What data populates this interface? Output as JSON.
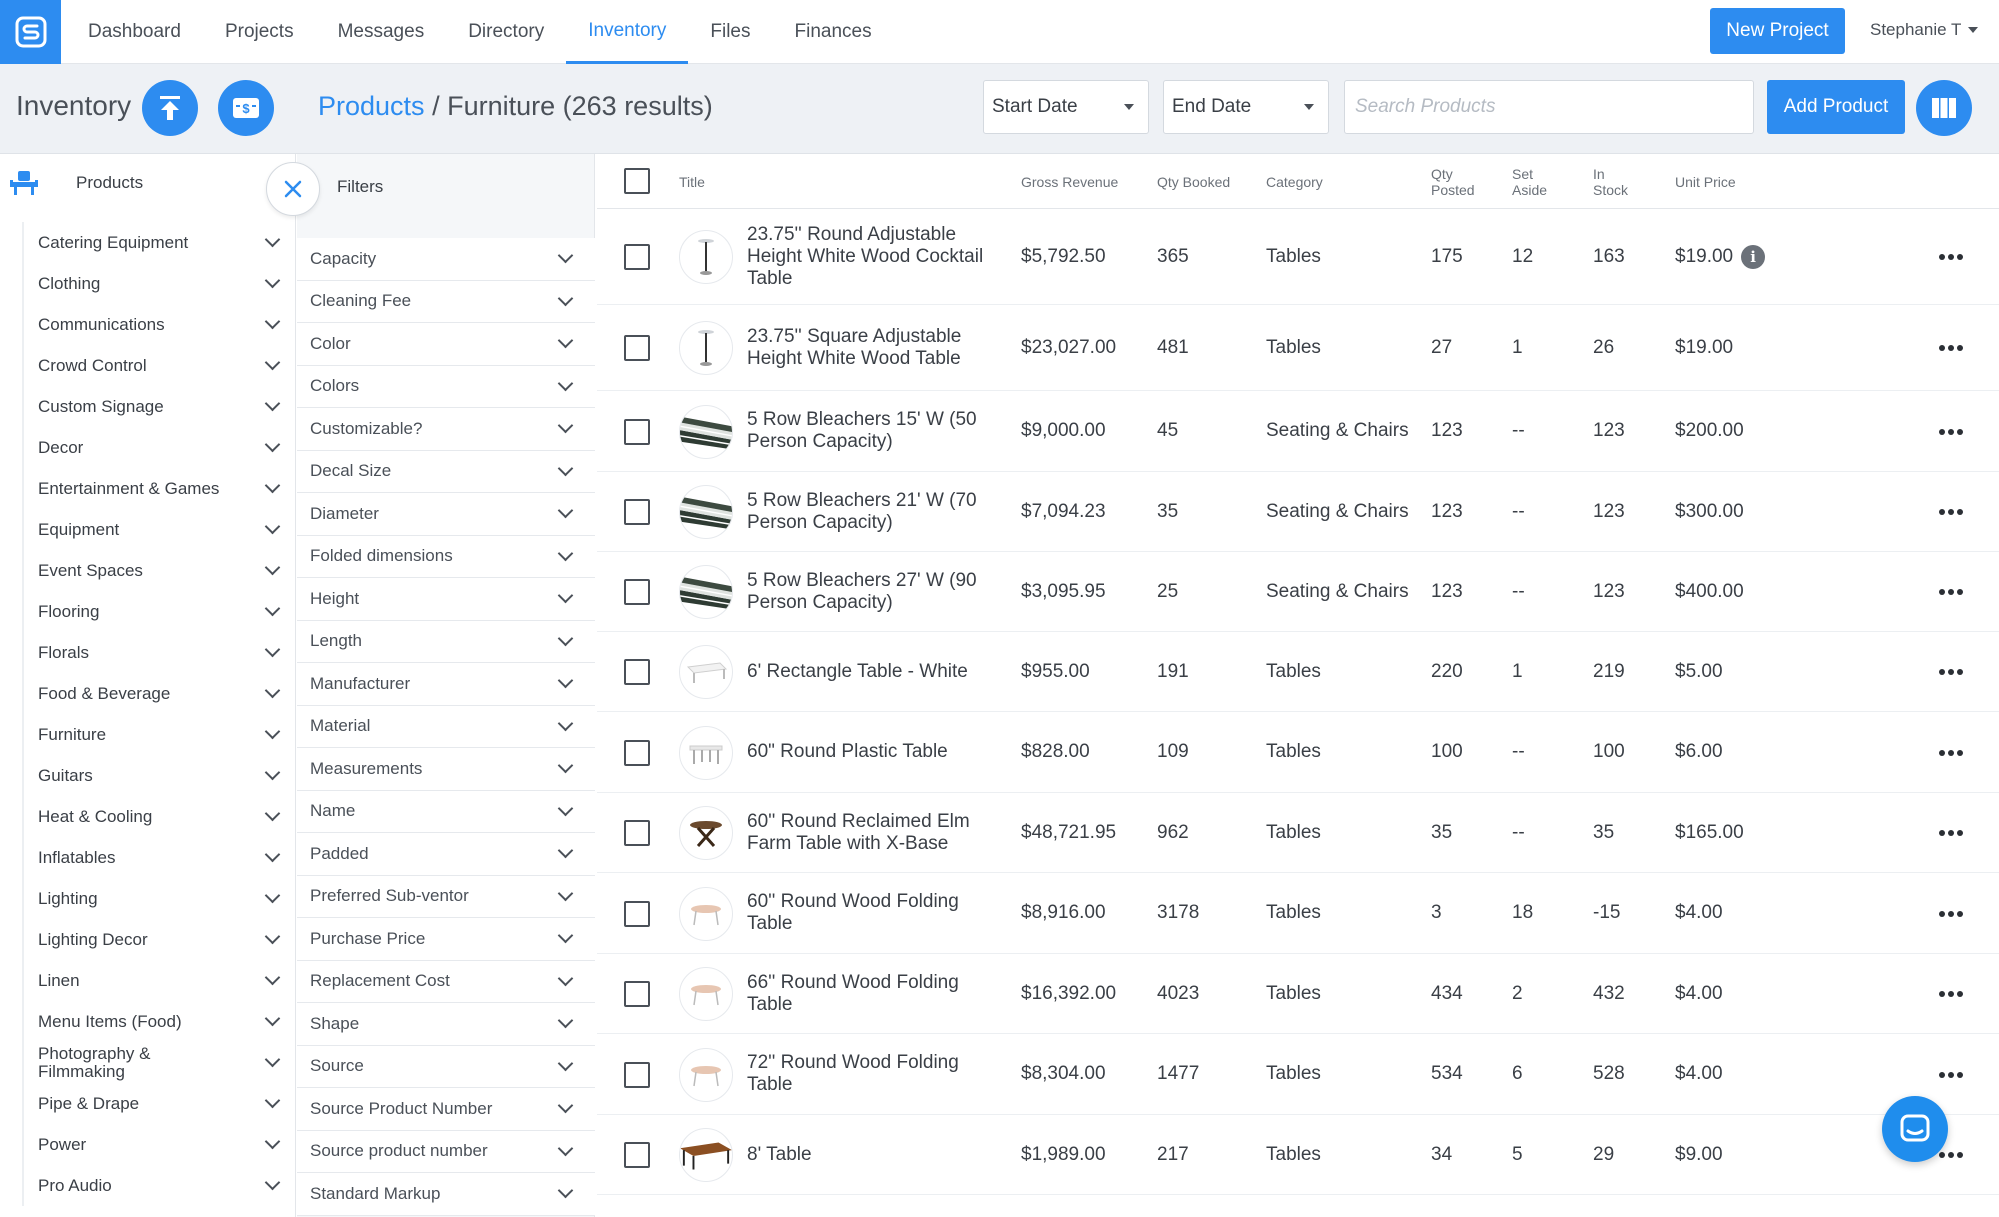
{
  "colors": {
    "accent": "#2d8cf0"
  },
  "nav": {
    "tabs": [
      {
        "label": "Dashboard"
      },
      {
        "label": "Projects"
      },
      {
        "label": "Messages"
      },
      {
        "label": "Directory"
      },
      {
        "label": "Inventory"
      },
      {
        "label": "Files"
      },
      {
        "label": "Finances"
      }
    ],
    "active_tab": "Inventory",
    "new_project_label": "New Project",
    "user_name": "Stephanie T"
  },
  "subheader": {
    "title": "Inventory",
    "breadcrumb_link": "Products",
    "breadcrumb_sep": "/",
    "breadcrumb_current": "Furniture (263 results)",
    "start_date_label": "Start Date",
    "end_date_label": "End Date",
    "search_placeholder": "Search Products",
    "add_product_label": "Add Product"
  },
  "categories": {
    "header": "Products",
    "items": [
      {
        "label": "Catering Equipment"
      },
      {
        "label": "Clothing"
      },
      {
        "label": "Communications"
      },
      {
        "label": "Crowd Control"
      },
      {
        "label": "Custom Signage"
      },
      {
        "label": "Decor"
      },
      {
        "label": "Entertainment & Games"
      },
      {
        "label": "Equipment"
      },
      {
        "label": "Event Spaces"
      },
      {
        "label": "Flooring"
      },
      {
        "label": "Florals"
      },
      {
        "label": "Food & Beverage"
      },
      {
        "label": "Furniture"
      },
      {
        "label": "Guitars"
      },
      {
        "label": "Heat & Cooling"
      },
      {
        "label": "Inflatables"
      },
      {
        "label": "Lighting"
      },
      {
        "label": "Lighting Decor"
      },
      {
        "label": "Linen"
      },
      {
        "label": "Menu Items (Food)"
      },
      {
        "label": "Photography & Filmmaking"
      },
      {
        "label": "Pipe & Drape"
      },
      {
        "label": "Power"
      },
      {
        "label": "Pro Audio"
      }
    ]
  },
  "filters": {
    "title": "Filters",
    "items": [
      {
        "label": "Capacity"
      },
      {
        "label": "Cleaning Fee"
      },
      {
        "label": "Color"
      },
      {
        "label": "Colors"
      },
      {
        "label": "Customizable?"
      },
      {
        "label": "Decal Size"
      },
      {
        "label": "Diameter"
      },
      {
        "label": "Folded dimensions"
      },
      {
        "label": "Height"
      },
      {
        "label": "Length"
      },
      {
        "label": "Manufacturer"
      },
      {
        "label": "Material"
      },
      {
        "label": "Measurements"
      },
      {
        "label": "Name"
      },
      {
        "label": "Padded"
      },
      {
        "label": "Preferred Sub-ventor"
      },
      {
        "label": "Purchase Price"
      },
      {
        "label": "Replacement Cost"
      },
      {
        "label": "Shape"
      },
      {
        "label": "Source"
      },
      {
        "label": "Source Product Number"
      },
      {
        "label": "Source product number"
      },
      {
        "label": "Standard Markup"
      }
    ]
  },
  "table": {
    "headers": {
      "title": "Title",
      "gross_revenue": "Gross Revenue",
      "qty_booked": "Qty Booked",
      "category": "Category",
      "qty_posted": "Qty Posted",
      "set_aside": "Set Aside",
      "in_stock": "In Stock",
      "unit_price": "Unit Price"
    },
    "rows": [
      {
        "title": "23.75'' Round Adjustable Height White Wood Cocktail Table",
        "gross_revenue": "$5,792.50",
        "qty_booked": "365",
        "category": "Tables",
        "qty_posted": "175",
        "set_aside": "12",
        "in_stock": "163",
        "unit_price": "$19.00",
        "thumb": "cocktail-table",
        "info": "i"
      },
      {
        "title": "23.75'' Square Adjustable Height White Wood Table",
        "gross_revenue": "$23,027.00",
        "qty_booked": "481",
        "category": "Tables",
        "qty_posted": "27",
        "set_aside": "1",
        "in_stock": "26",
        "unit_price": "$19.00",
        "thumb": "cocktail-table"
      },
      {
        "title": "5 Row Bleachers 15' W (50 Person Capacity)",
        "gross_revenue": "$9,000.00",
        "qty_booked": "45",
        "category": "Seating & Chairs",
        "qty_posted": "123",
        "set_aside": "--",
        "in_stock": "123",
        "unit_price": "$200.00",
        "thumb": "bleachers"
      },
      {
        "title": "5 Row Bleachers 21' W (70 Person Capacity)",
        "gross_revenue": "$7,094.23",
        "qty_booked": "35",
        "category": "Seating & Chairs",
        "qty_posted": "123",
        "set_aside": "--",
        "in_stock": "123",
        "unit_price": "$300.00",
        "thumb": "bleachers"
      },
      {
        "title": "5 Row Bleachers 27' W (90 Person Capacity)",
        "gross_revenue": "$3,095.95",
        "qty_booked": "25",
        "category": "Seating & Chairs",
        "qty_posted": "123",
        "set_aside": "--",
        "in_stock": "123",
        "unit_price": "$400.00",
        "thumb": "bleachers"
      },
      {
        "title": "6' Rectangle Table - White",
        "gross_revenue": "$955.00",
        "qty_booked": "191",
        "category": "Tables",
        "qty_posted": "220",
        "set_aside": "1",
        "in_stock": "219",
        "unit_price": "$5.00",
        "thumb": "rect-table"
      },
      {
        "title": "60\" Round Plastic Table",
        "gross_revenue": "$828.00",
        "qty_booked": "109",
        "category": "Tables",
        "qty_posted": "100",
        "set_aside": "--",
        "in_stock": "100",
        "unit_price": "$6.00",
        "thumb": "plastic-table"
      },
      {
        "title": "60'' Round Reclaimed Elm Farm Table with X-Base",
        "gross_revenue": "$48,721.95",
        "qty_booked": "962",
        "category": "Tables",
        "qty_posted": "35",
        "set_aside": "--",
        "in_stock": "35",
        "unit_price": "$165.00",
        "thumb": "elm-table"
      },
      {
        "title": "60'' Round Wood Folding Table",
        "gross_revenue": "$8,916.00",
        "qty_booked": "3178",
        "category": "Tables",
        "qty_posted": "3",
        "set_aside": "18",
        "in_stock": "-15",
        "unit_price": "$4.00",
        "thumb": "folding-table"
      },
      {
        "title": "66'' Round Wood Folding Table",
        "gross_revenue": "$16,392.00",
        "qty_booked": "4023",
        "category": "Tables",
        "qty_posted": "434",
        "set_aside": "2",
        "in_stock": "432",
        "unit_price": "$4.00",
        "thumb": "folding-table"
      },
      {
        "title": "72'' Round Wood Folding Table",
        "gross_revenue": "$8,304.00",
        "qty_booked": "1477",
        "category": "Tables",
        "qty_posted": "534",
        "set_aside": "6",
        "in_stock": "528",
        "unit_price": "$4.00",
        "thumb": "folding-table"
      },
      {
        "title": "8' Table",
        "gross_revenue": "$1,989.00",
        "qty_booked": "217",
        "category": "Tables",
        "qty_posted": "34",
        "set_aside": "5",
        "in_stock": "29",
        "unit_price": "$9.00",
        "thumb": "wood-table"
      }
    ]
  }
}
